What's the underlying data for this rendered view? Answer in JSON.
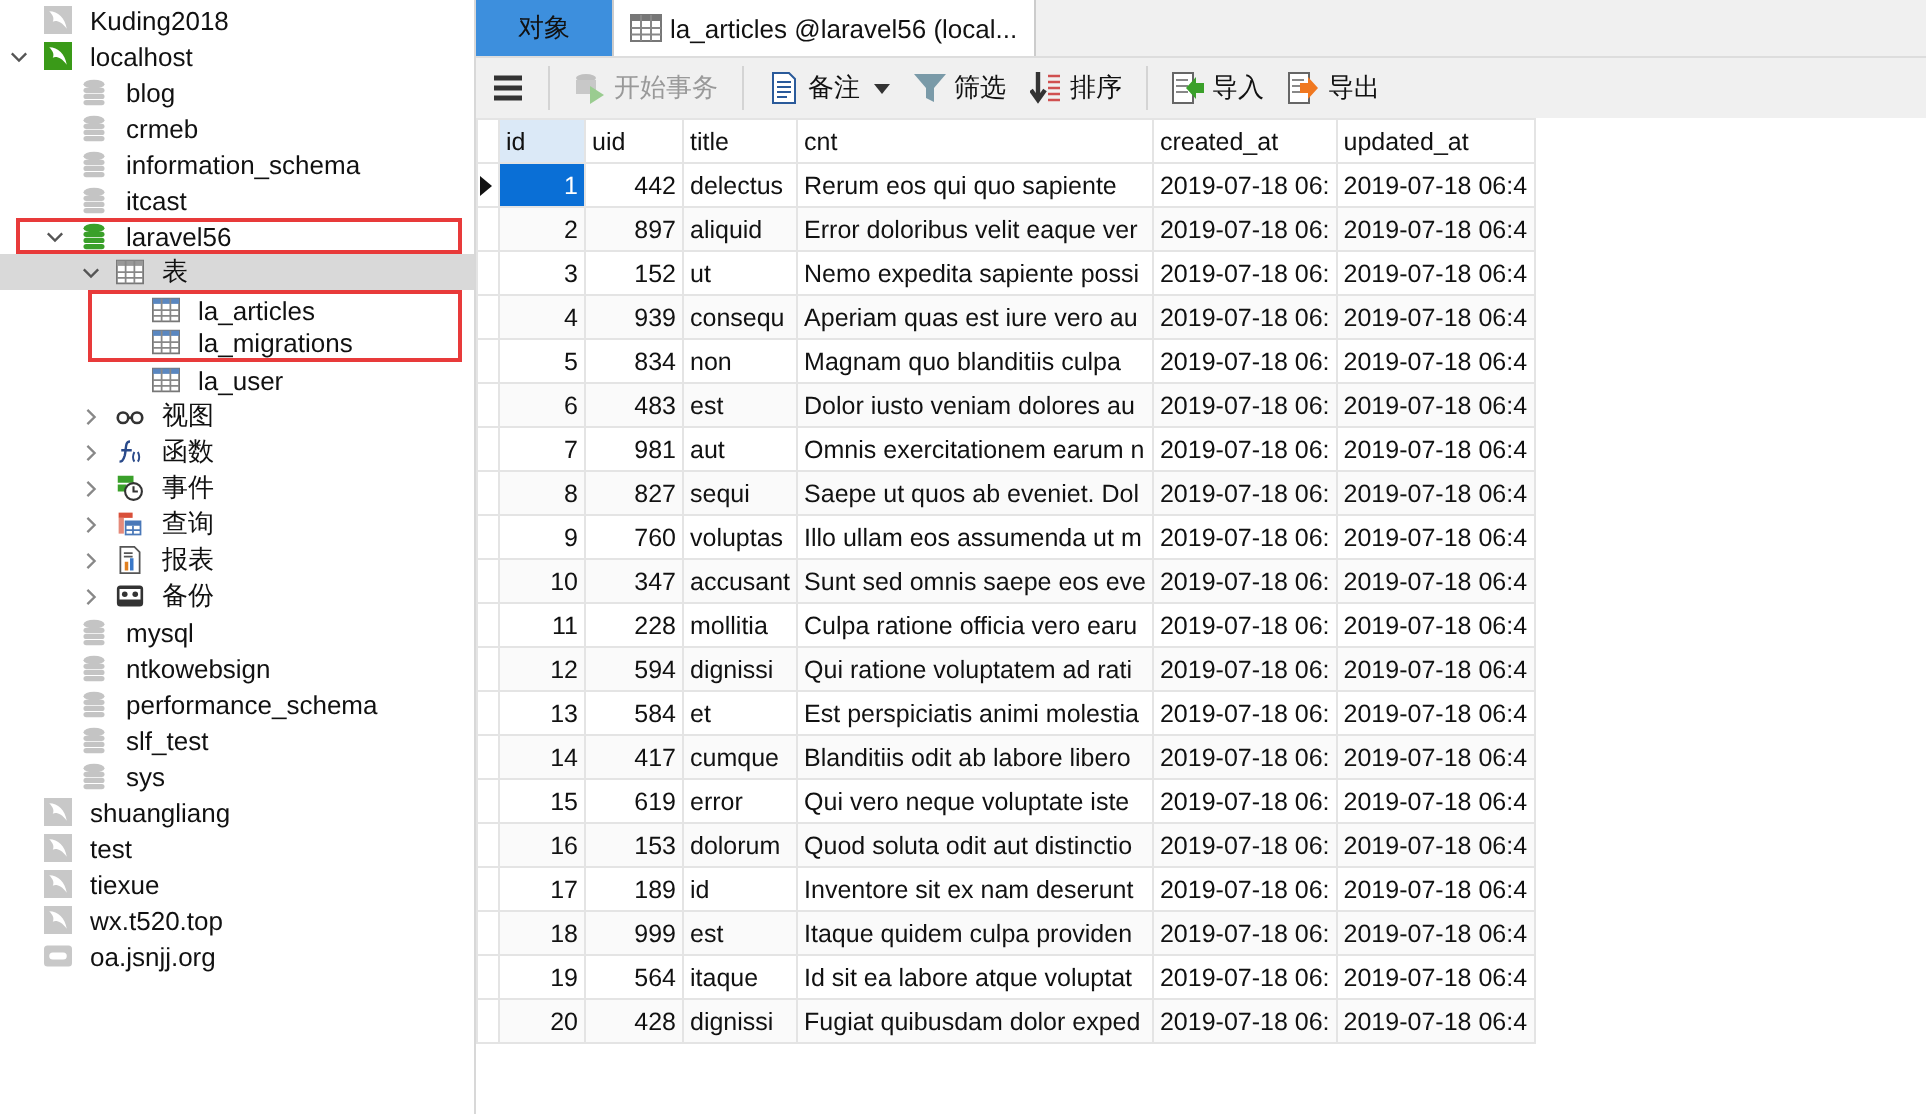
{
  "tree": [
    {
      "label": "Kuding2018",
      "kind": "connection"
    },
    {
      "label": "localhost",
      "kind": "open-connection",
      "expanded": true,
      "children": [
        {
          "label": "blog",
          "kind": "database"
        },
        {
          "label": "crmeb",
          "kind": "database"
        },
        {
          "label": "information_schema",
          "kind": "database"
        },
        {
          "label": "itcast",
          "kind": "database"
        },
        {
          "label": "laravel56",
          "kind": "open-database",
          "expanded": true,
          "outlined": true,
          "children": [
            {
              "label": "表",
              "kind": "tables",
              "expanded": true,
              "selected": true,
              "children": [
                {
                  "label": "la_articles",
                  "kind": "table",
                  "outlined": true
                },
                {
                  "label": "la_migrations",
                  "kind": "table",
                  "outlined": true
                },
                {
                  "label": "la_user",
                  "kind": "table",
                  "outlined": false
                }
              ]
            },
            {
              "label": "视图",
              "kind": "views",
              "expanded": false
            },
            {
              "label": "函数",
              "kind": "functions",
              "expanded": false
            },
            {
              "label": "事件",
              "kind": "events",
              "expanded": false
            },
            {
              "label": "查询",
              "kind": "queries",
              "expanded": false
            },
            {
              "label": "报表",
              "kind": "reports",
              "expanded": false
            },
            {
              "label": "备份",
              "kind": "backups",
              "expanded": false
            }
          ]
        },
        {
          "label": "mysql",
          "kind": "database"
        },
        {
          "label": "ntkowebsign",
          "kind": "database"
        },
        {
          "label": "performance_schema",
          "kind": "database"
        },
        {
          "label": "slf_test",
          "kind": "database"
        },
        {
          "label": "sys",
          "kind": "database"
        }
      ]
    },
    {
      "label": "shuangliang",
      "kind": "connection"
    },
    {
      "label": "test",
      "kind": "connection"
    },
    {
      "label": "tiexue",
      "kind": "connection"
    },
    {
      "label": "wx.t520.top",
      "kind": "connection"
    },
    {
      "label": "oa.jsnjj.org",
      "kind": "other"
    }
  ],
  "tabs": [
    {
      "label": "对象",
      "kind": "objects",
      "selected": true
    },
    {
      "label": "la_articles @laravel56 (local...",
      "kind": "table",
      "selected": false
    }
  ],
  "toolbar": [
    {
      "kind": "menu"
    },
    {
      "kind": "transaction",
      "label": "开始事务",
      "disabled": true
    },
    {
      "kind": "memo",
      "label": "备注"
    },
    {
      "kind": "filter",
      "label": "筛选"
    },
    {
      "kind": "sort",
      "label": "排序"
    },
    {
      "kind": "import",
      "label": "导入"
    },
    {
      "kind": "export",
      "label": "导出"
    }
  ],
  "table": {
    "columns": [
      {
        "label": "id",
        "selected": true
      },
      {
        "label": "uid",
        "selected": false
      },
      {
        "label": "title",
        "selected": false
      },
      {
        "label": "cnt",
        "selected": false
      },
      {
        "label": "created_at",
        "selected": false
      },
      {
        "label": "updated_at",
        "selected": false
      }
    ],
    "rows": [
      {
        "selected": true,
        "cells": [
          "1",
          "442",
          "delectus",
          "Rerum eos qui quo sapiente",
          "2019-07-18 06:",
          "2019-07-18 06:4"
        ]
      },
      {
        "selected": false,
        "cells": [
          "2",
          "897",
          "aliquid",
          "Error doloribus velit eaque ver",
          "2019-07-18 06:",
          "2019-07-18 06:4"
        ]
      },
      {
        "selected": false,
        "cells": [
          "3",
          "152",
          "ut",
          "Nemo expedita sapiente possi",
          "2019-07-18 06:",
          "2019-07-18 06:4"
        ]
      },
      {
        "selected": false,
        "cells": [
          "4",
          "939",
          "consequ",
          "Aperiam quas est iure vero au",
          "2019-07-18 06:",
          "2019-07-18 06:4"
        ]
      },
      {
        "selected": false,
        "cells": [
          "5",
          "834",
          "non",
          "Magnam quo blanditiis culpa",
          "2019-07-18 06:",
          "2019-07-18 06:4"
        ]
      },
      {
        "selected": false,
        "cells": [
          "6",
          "483",
          "est",
          "Dolor iusto veniam dolores au",
          "2019-07-18 06:",
          "2019-07-18 06:4"
        ]
      },
      {
        "selected": false,
        "cells": [
          "7",
          "981",
          "aut",
          "Omnis exercitationem earum n",
          "2019-07-18 06:",
          "2019-07-18 06:4"
        ]
      },
      {
        "selected": false,
        "cells": [
          "8",
          "827",
          "sequi",
          "Saepe ut quos ab eveniet. Dol",
          "2019-07-18 06:",
          "2019-07-18 06:4"
        ]
      },
      {
        "selected": false,
        "cells": [
          "9",
          "760",
          "voluptas",
          "Illo ullam eos assumenda ut m",
          "2019-07-18 06:",
          "2019-07-18 06:4"
        ]
      },
      {
        "selected": false,
        "cells": [
          "10",
          "347",
          "accusant",
          "Sunt sed omnis saepe eos eve",
          "2019-07-18 06:",
          "2019-07-18 06:4"
        ]
      },
      {
        "selected": false,
        "cells": [
          "11",
          "228",
          "mollitia",
          "Culpa ratione officia vero earu",
          "2019-07-18 06:",
          "2019-07-18 06:4"
        ]
      },
      {
        "selected": false,
        "cells": [
          "12",
          "594",
          "dignissi",
          "Qui ratione voluptatem ad rati",
          "2019-07-18 06:",
          "2019-07-18 06:4"
        ]
      },
      {
        "selected": false,
        "cells": [
          "13",
          "584",
          "et",
          "Est perspiciatis animi molestia",
          "2019-07-18 06:",
          "2019-07-18 06:4"
        ]
      },
      {
        "selected": false,
        "cells": [
          "14",
          "417",
          "cumque",
          "Blanditiis odit ab labore libero",
          "2019-07-18 06:",
          "2019-07-18 06:4"
        ]
      },
      {
        "selected": false,
        "cells": [
          "15",
          "619",
          "error",
          "Qui vero neque voluptate iste",
          "2019-07-18 06:",
          "2019-07-18 06:4"
        ]
      },
      {
        "selected": false,
        "cells": [
          "16",
          "153",
          "dolorum",
          "Quod soluta odit aut distinctio",
          "2019-07-18 06:",
          "2019-07-18 06:4"
        ]
      },
      {
        "selected": false,
        "cells": [
          "17",
          "189",
          "id",
          "Inventore sit ex nam deserunt",
          "2019-07-18 06:",
          "2019-07-18 06:4"
        ]
      },
      {
        "selected": false,
        "cells": [
          "18",
          "999",
          "est",
          "Itaque quidem culpa providen",
          "2019-07-18 06:",
          "2019-07-18 06:4"
        ]
      },
      {
        "selected": false,
        "cells": [
          "19",
          "564",
          "itaque",
          "Id sit ea labore atque voluptat",
          "2019-07-18 06:",
          "2019-07-18 06:4"
        ]
      },
      {
        "selected": false,
        "cells": [
          "20",
          "428",
          "dignissi",
          "Fugiat quibusdam dolor exped",
          "2019-07-18 06:",
          "2019-07-18 06:4"
        ]
      }
    ]
  }
}
